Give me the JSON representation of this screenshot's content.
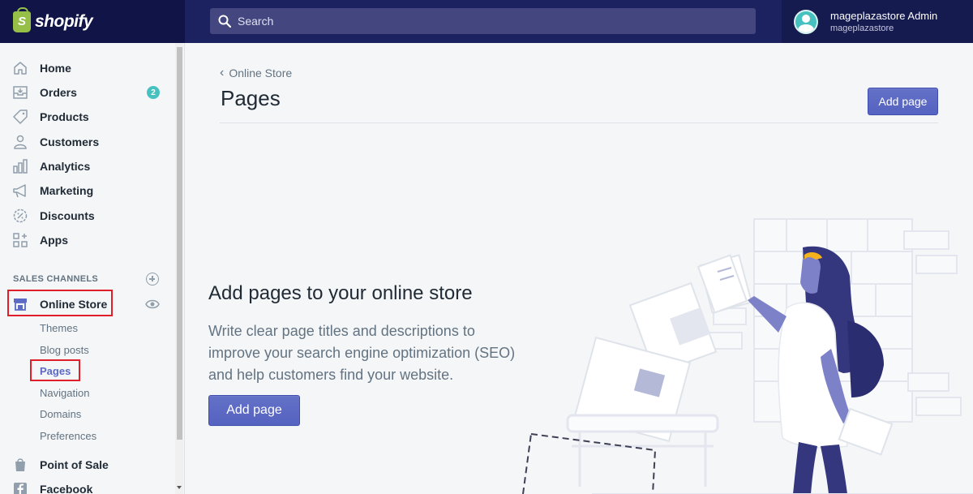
{
  "topbar": {
    "brand": "shopify",
    "search_placeholder": "Search",
    "user_name": "mageplazastore Admin",
    "user_store": "mageplazastore"
  },
  "sidebar": {
    "items": [
      {
        "label": "Home",
        "icon": "home-icon"
      },
      {
        "label": "Orders",
        "icon": "orders-icon",
        "badge": "2"
      },
      {
        "label": "Products",
        "icon": "tag-icon"
      },
      {
        "label": "Customers",
        "icon": "person-icon"
      },
      {
        "label": "Analytics",
        "icon": "bar-chart-icon"
      },
      {
        "label": "Marketing",
        "icon": "megaphone-icon"
      },
      {
        "label": "Discounts",
        "icon": "discount-icon"
      },
      {
        "label": "Apps",
        "icon": "apps-icon"
      }
    ],
    "section_title": "SALES CHANNELS",
    "online_store": "Online Store",
    "sub_items": [
      "Themes",
      "Blog posts",
      "Pages",
      "Navigation",
      "Domains",
      "Preferences"
    ],
    "point_of_sale": "Point of Sale",
    "facebook": "Facebook"
  },
  "main": {
    "breadcrumb": "Online Store",
    "title": "Pages",
    "add_page_label": "Add page",
    "empty_title": "Add pages to your online store",
    "empty_desc": "Write clear page titles and descriptions to improve your search engine optimization (SEO) and help customers find your website."
  },
  "colors": {
    "topbar": "#1c2260",
    "primary": "#5c6ac4",
    "badge": "#47c1bf",
    "highlight": "#e01f2a"
  }
}
